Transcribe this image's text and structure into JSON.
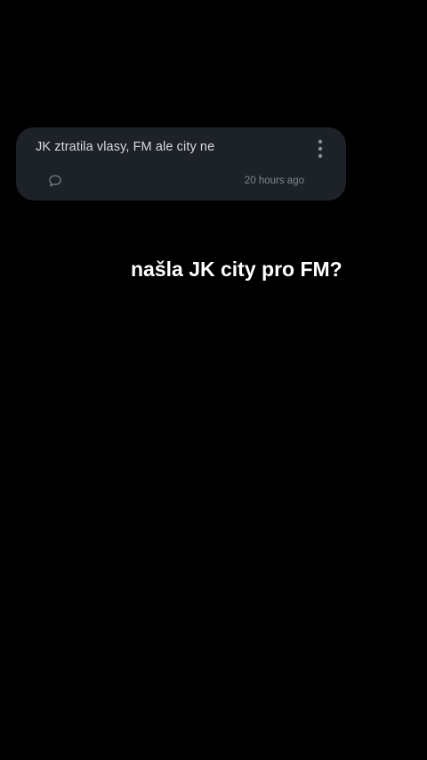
{
  "card": {
    "text": "JK ztratila vlasy, FM ale city ne",
    "timestamp": "20 hours ago",
    "comment_icon": "speech-bubble-icon",
    "menu_icon": "more-vertical-icon"
  },
  "overlay": {
    "caption": "našla JK city pro FM?"
  },
  "colors": {
    "background": "#000000",
    "card_background": "#1d2228",
    "card_text": "#d7d9dc",
    "muted_text": "#7e858d",
    "caption_text": "#ffffff"
  }
}
